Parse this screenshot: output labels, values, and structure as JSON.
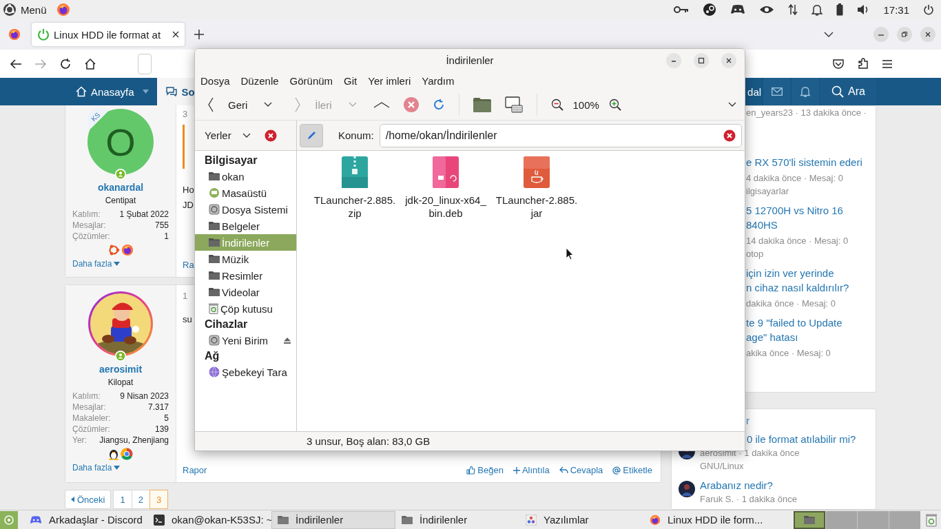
{
  "top_panel": {
    "menu_label": "Menü",
    "clock": "17:31"
  },
  "browser": {
    "tabs": [
      {
        "title": "Linux HDD ile format at",
        "selected": true
      }
    ]
  },
  "site_nav": {
    "items": [
      {
        "label": "Anasayfa",
        "selected": false
      },
      {
        "label": "So",
        "selected": true
      }
    ],
    "user_label": "dal",
    "search_label": "Ara"
  },
  "posts": [
    {
      "user": {
        "avatar": {
          "kind": "letter",
          "initial": "O",
          "badge": "KS"
        },
        "name": "okanardal",
        "title": "Centipat",
        "stats": [
          {
            "label": "Katılım:",
            "value": "1 Şubat 2022"
          },
          {
            "label": "Mesajlar:",
            "value": "755"
          },
          {
            "label": "Çözümler:",
            "value": "1"
          }
        ],
        "badges": [
          {
            "kind": "ubuntu"
          },
          {
            "kind": "firefox"
          }
        ],
        "more": "Daha fazla"
      },
      "date": "3",
      "body": [
        "Ho",
        "JD"
      ],
      "quote": true,
      "report": "Ra"
    },
    {
      "user": {
        "name": "aerosimit",
        "title": "Kilopat",
        "stats": [
          {
            "label": "Katılım:",
            "value": "9 Nisan 2023"
          },
          {
            "label": "Mesajlar:",
            "value": "7.317"
          },
          {
            "label": "Makaleler:",
            "value": "5"
          },
          {
            "label": "Çözümler:",
            "value": "139"
          },
          {
            "label": "Yer:",
            "value": "Jiangsu, Zhenjiang"
          }
        ],
        "badges": [
          {
            "kind": "tux"
          },
          {
            "kind": "chrome"
          }
        ],
        "more": "Daha fazla"
      },
      "date": "1",
      "body": [
        "su"
      ],
      "quote": false,
      "report": "Rapor",
      "actions": [
        {
          "kind": "like",
          "label": "Beğen"
        },
        {
          "kind": "quote",
          "label": "Alıntıla"
        },
        {
          "kind": "reply",
          "label": "Cevapla"
        },
        {
          "kind": "tag",
          "label": "Etiketle"
        }
      ]
    }
  ],
  "pagination": {
    "prev": "Önceki",
    "pages": [
      {
        "label": "1",
        "selected": false
      },
      {
        "label": "2",
        "selected": false
      },
      {
        "label": "3",
        "selected": true
      }
    ]
  },
  "latest_threads": [
    {
      "meta": "en_years23 · 13 dakika önce ·"
    },
    {
      "title_lines": [
        "e RX 570'li sistemin ederi"
      ],
      "meta": "4 dakika önce · Mesaj: 0",
      "category": "ilgisayarlar"
    },
    {
      "title_lines": [
        "5 12700H vs Nitro 16",
        "840HS"
      ],
      "meta": "14 dakika önce · Mesaj: 0",
      "category": "otop"
    },
    {
      "title_lines": [
        "için izin ver yerinde",
        "n cihaz nasıl kaldırılır?"
      ],
      "meta": "dakika önce · Mesaj: 0"
    },
    {
      "title_lines": [
        "te 9 \"failed to Update",
        "age\" hatası"
      ],
      "meta": "akika önce · Mesaj: 0"
    }
  ],
  "latest_posts": {
    "heading": "r",
    "items": [
      {
        "title": "0 ile format atılabilir mi?",
        "meta": "aerosimit · 1 dakika önce",
        "category": "GNU/Linux"
      },
      {
        "title": "Arabanız nedir?",
        "meta": "Faruk S. · 1 dakika önce"
      }
    ]
  },
  "file_manager": {
    "title": "İndirilenler",
    "menu": [
      "Dosya",
      "Düzenle",
      "Görünüm",
      "Git",
      "Yer imleri",
      "Yardım"
    ],
    "toolbar": {
      "back": "Geri",
      "forward": "İleri",
      "forward_disabled": true,
      "zoom": "100%"
    },
    "places_label": "Yerler",
    "location_label": "Konum:",
    "location": "/home/okan/İndirilenler",
    "sidebar": [
      {
        "heading": "Bilgisayar",
        "items": [
          {
            "label": "okan",
            "kind": "folder",
            "selected": false
          },
          {
            "label": "Masaüstü",
            "kind": "desktop",
            "selected": false
          },
          {
            "label": "Dosya Sistemi",
            "kind": "disk",
            "selected": false
          },
          {
            "label": "Belgeler",
            "kind": "folder",
            "selected": false
          },
          {
            "label": "İndirilenler",
            "kind": "folder",
            "selected": true
          },
          {
            "label": "Müzik",
            "kind": "folder",
            "selected": false
          },
          {
            "label": "Resimler",
            "kind": "folder",
            "selected": false
          },
          {
            "label": "Videolar",
            "kind": "folder",
            "selected": false
          },
          {
            "label": "Çöp kutusu",
            "kind": "trash",
            "selected": false
          }
        ]
      },
      {
        "heading": "Cihazlar",
        "items": [
          {
            "label": "Yeni Birim",
            "kind": "disk",
            "selected": false,
            "eject": true
          }
        ]
      },
      {
        "heading": "Ağ",
        "items": [
          {
            "label": "Şebekeyi Tara",
            "kind": "network",
            "selected": false
          }
        ]
      }
    ],
    "files": [
      {
        "kind": "zip",
        "name_lines": [
          "TLauncher-2.885.",
          "zip"
        ]
      },
      {
        "kind": "deb",
        "name_lines": [
          "jdk-20_linux-x64_",
          "bin.deb"
        ]
      },
      {
        "kind": "jar",
        "name_lines": [
          "TLauncher-2.885.",
          "jar"
        ]
      }
    ],
    "status": "3 unsur, Boş alan: 83,0 GB"
  },
  "taskbar": {
    "items": [
      {
        "label": "Arkadaşlar - Discord",
        "kind": "chat",
        "selected": false
      },
      {
        "label": "okan@okan-K53SJ: ~",
        "kind": "terminal",
        "selected": false
      },
      {
        "label": "İndirilenler",
        "kind": "folder",
        "selected": true
      },
      {
        "label": "İndirilenler",
        "kind": "folder",
        "selected": false
      },
      {
        "label": "Yazılımlar",
        "kind": "apps",
        "selected": false
      },
      {
        "label": "Linux HDD ile form...",
        "kind": "browser",
        "selected": false
      }
    ],
    "workspaces": [
      {
        "selected": true
      },
      {
        "selected": false
      },
      {
        "selected": false
      },
      {
        "selected": false
      }
    ]
  }
}
